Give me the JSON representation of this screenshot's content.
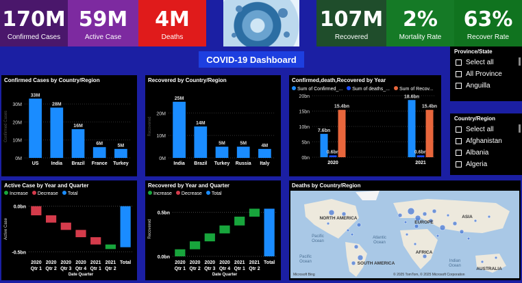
{
  "kpis": [
    {
      "value": "170M",
      "label": "Confirmed Cases",
      "color": "#4a176b"
    },
    {
      "value": "59M",
      "label": "Active Case",
      "color": "#7d2aa0"
    },
    {
      "value": "4M",
      "label": "Deaths",
      "color": "#e01b1b"
    },
    {
      "value": "107M",
      "label": "Recovered",
      "color": "#1f4d2b"
    },
    {
      "value": "2%",
      "label": "Mortality Rate",
      "color": "#157a26"
    },
    {
      "value": "63%",
      "label": "Recover Rate",
      "color": "#10731f"
    }
  ],
  "dashboard_title": "COVID-19 Dashboard",
  "slicers": {
    "province": {
      "title": "Province/State",
      "items": [
        "Select all",
        "All Province",
        "Anguilla"
      ]
    },
    "country": {
      "title": "Country/Region",
      "items": [
        "Select all",
        "Afghanistan",
        "Albania",
        "Algeria"
      ]
    }
  },
  "legend_waterfall": {
    "increase": "Increase",
    "decrease": "Decrease",
    "total": "Total"
  },
  "colors": {
    "bar_blue": "#1a8cff",
    "orange": "#e8663c",
    "increase": "#18a53c",
    "decrease": "#d43b4b",
    "total": "#1a8cff"
  },
  "map": {
    "title": "Deaths by Country/Region",
    "labels": [
      "NORTH AMERICA",
      "EUROPE",
      "ASIA",
      "Pacific Ocean",
      "Atlantic Ocean",
      "AFRICA",
      "Pacific Ocean",
      "SOUTH AMERICA",
      "Indian Ocean",
      "AUSTRALIA"
    ],
    "attribution": "© 2025 TomTom, © 2025 Microsoft Corporation",
    "brand": "Microsoft Bing"
  },
  "chart_data": [
    {
      "type": "bar",
      "title": "Confirmed Cases by Country/Region",
      "ylabel": "Confirmed Cases",
      "categories": [
        "US",
        "India",
        "Brazil",
        "France",
        "Turkey"
      ],
      "values": [
        33,
        28,
        16,
        6,
        5
      ],
      "data_labels": [
        "33M",
        "28M",
        "16M",
        "6M",
        "5M"
      ],
      "yticks": [
        "0M",
        "10M",
        "20M",
        "30M"
      ],
      "ylim": [
        0,
        35
      ]
    },
    {
      "type": "bar",
      "title": "Recovered by Country/Region",
      "ylabel": "Recovered",
      "categories": [
        "India",
        "Brazil",
        "Turkey",
        "Russia",
        "Italy"
      ],
      "values": [
        25,
        14,
        5,
        5,
        4
      ],
      "data_labels": [
        "25M",
        "14M",
        "5M",
        "5M",
        "4M"
      ],
      "yticks": [
        "0M",
        "10M",
        "20M"
      ],
      "ylim": [
        0,
        28
      ]
    },
    {
      "type": "bar",
      "title": "Confirmed,death,Recovered by Year",
      "categories": [
        "2020",
        "2021"
      ],
      "legend": [
        "Sum of Confirmed_...",
        "Sum of deaths_...",
        "Sum of Recov..."
      ],
      "series": [
        {
          "name": "Sum of Confirmed_...",
          "values": [
            7.6,
            18.6
          ],
          "labels": [
            "7.6bn",
            "18.6bn"
          ]
        },
        {
          "name": "Sum of deaths_...",
          "values": [
            0.6,
            0.6
          ],
          "labels": [
            "0.6bn",
            "0.6bn"
          ]
        },
        {
          "name": "Sum of Recov...",
          "values": [
            15.4,
            15.4
          ],
          "labels": [
            "15.4bn",
            "15.4bn"
          ]
        }
      ],
      "yticks": [
        "0bn",
        "5bn",
        "10bn",
        "15bn",
        "20bn"
      ],
      "ylim": [
        0,
        20
      ]
    },
    {
      "type": "bar",
      "title": "Active Case by Year and Quarter",
      "ylabel": "Active Case",
      "xlabel": "Date Quarter",
      "categories": [
        [
          "2020",
          "Qtr 1"
        ],
        [
          "2020",
          "Qtr 2"
        ],
        [
          "2020",
          "Qtr 3"
        ],
        [
          "2020",
          "Qtr 4"
        ],
        [
          "2021",
          "Qtr 1"
        ],
        [
          "2021",
          "Qtr 2"
        ],
        [
          "Total",
          ""
        ]
      ],
      "steps": [
        {
          "start": 0,
          "end": -0.1,
          "kind": "decrease"
        },
        {
          "start": -0.1,
          "end": -0.18,
          "kind": "decrease"
        },
        {
          "start": -0.18,
          "end": -0.26,
          "kind": "decrease"
        },
        {
          "start": -0.26,
          "end": -0.34,
          "kind": "decrease"
        },
        {
          "start": -0.34,
          "end": -0.42,
          "kind": "decrease"
        },
        {
          "start": -0.42,
          "end": -0.47,
          "kind": "increase"
        },
        {
          "start": 0.0,
          "end": -0.45,
          "kind": "total"
        }
      ],
      "yticks": [
        "0.0bn",
        "-0.5bn"
      ],
      "ylim": [
        -0.55,
        0.05
      ]
    },
    {
      "type": "bar",
      "title": "Recovered by Year and Quarter",
      "ylabel": "Recovered",
      "xlabel": "Date Quarter",
      "categories": [
        [
          "2020",
          "Qtr 1"
        ],
        [
          "2020",
          "Qtr 2"
        ],
        [
          "2020",
          "Qtr 3"
        ],
        [
          "2020",
          "Qtr 4"
        ],
        [
          "2021",
          "Qtr 1"
        ],
        [
          "2021",
          "Qtr 2"
        ],
        [
          "Total",
          ""
        ]
      ],
      "steps": [
        {
          "start": 0,
          "end": 0.08,
          "kind": "increase"
        },
        {
          "start": 0.08,
          "end": 0.17,
          "kind": "increase"
        },
        {
          "start": 0.17,
          "end": 0.26,
          "kind": "increase"
        },
        {
          "start": 0.26,
          "end": 0.35,
          "kind": "increase"
        },
        {
          "start": 0.35,
          "end": 0.45,
          "kind": "increase"
        },
        {
          "start": 0.45,
          "end": 0.54,
          "kind": "increase"
        },
        {
          "start": 0,
          "end": 0.54,
          "kind": "total"
        }
      ],
      "yticks": [
        "0.0bn",
        "0.5bn"
      ],
      "ylim": [
        0,
        0.62
      ]
    }
  ]
}
